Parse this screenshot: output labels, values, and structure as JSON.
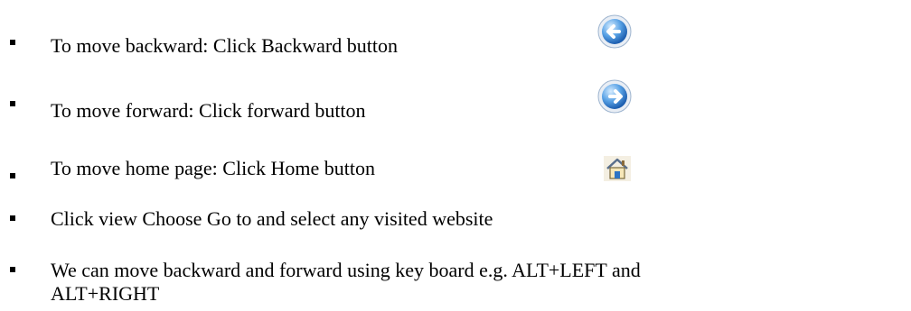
{
  "items": [
    {
      "text": "To move backward: Click Backward button",
      "icon": "back-arrow-icon"
    },
    {
      "text": "To move forward:  Click forward button",
      "icon": "forward-arrow-icon"
    },
    {
      "text": "To move home page: Click Home button",
      "icon": "home-icon"
    },
    {
      "text": "Click view Choose Go to and select any visited website"
    },
    {
      "text": "We can move backward and forward using key board e.g. ALT+LEFT and"
    },
    {
      "text": "ALT+RIGHT"
    }
  ],
  "colors": {
    "text": "#000000",
    "icon_blue_light": "#9fd0f5",
    "icon_blue_dark": "#2d74c4",
    "icon_home": "#f2e6c4"
  }
}
